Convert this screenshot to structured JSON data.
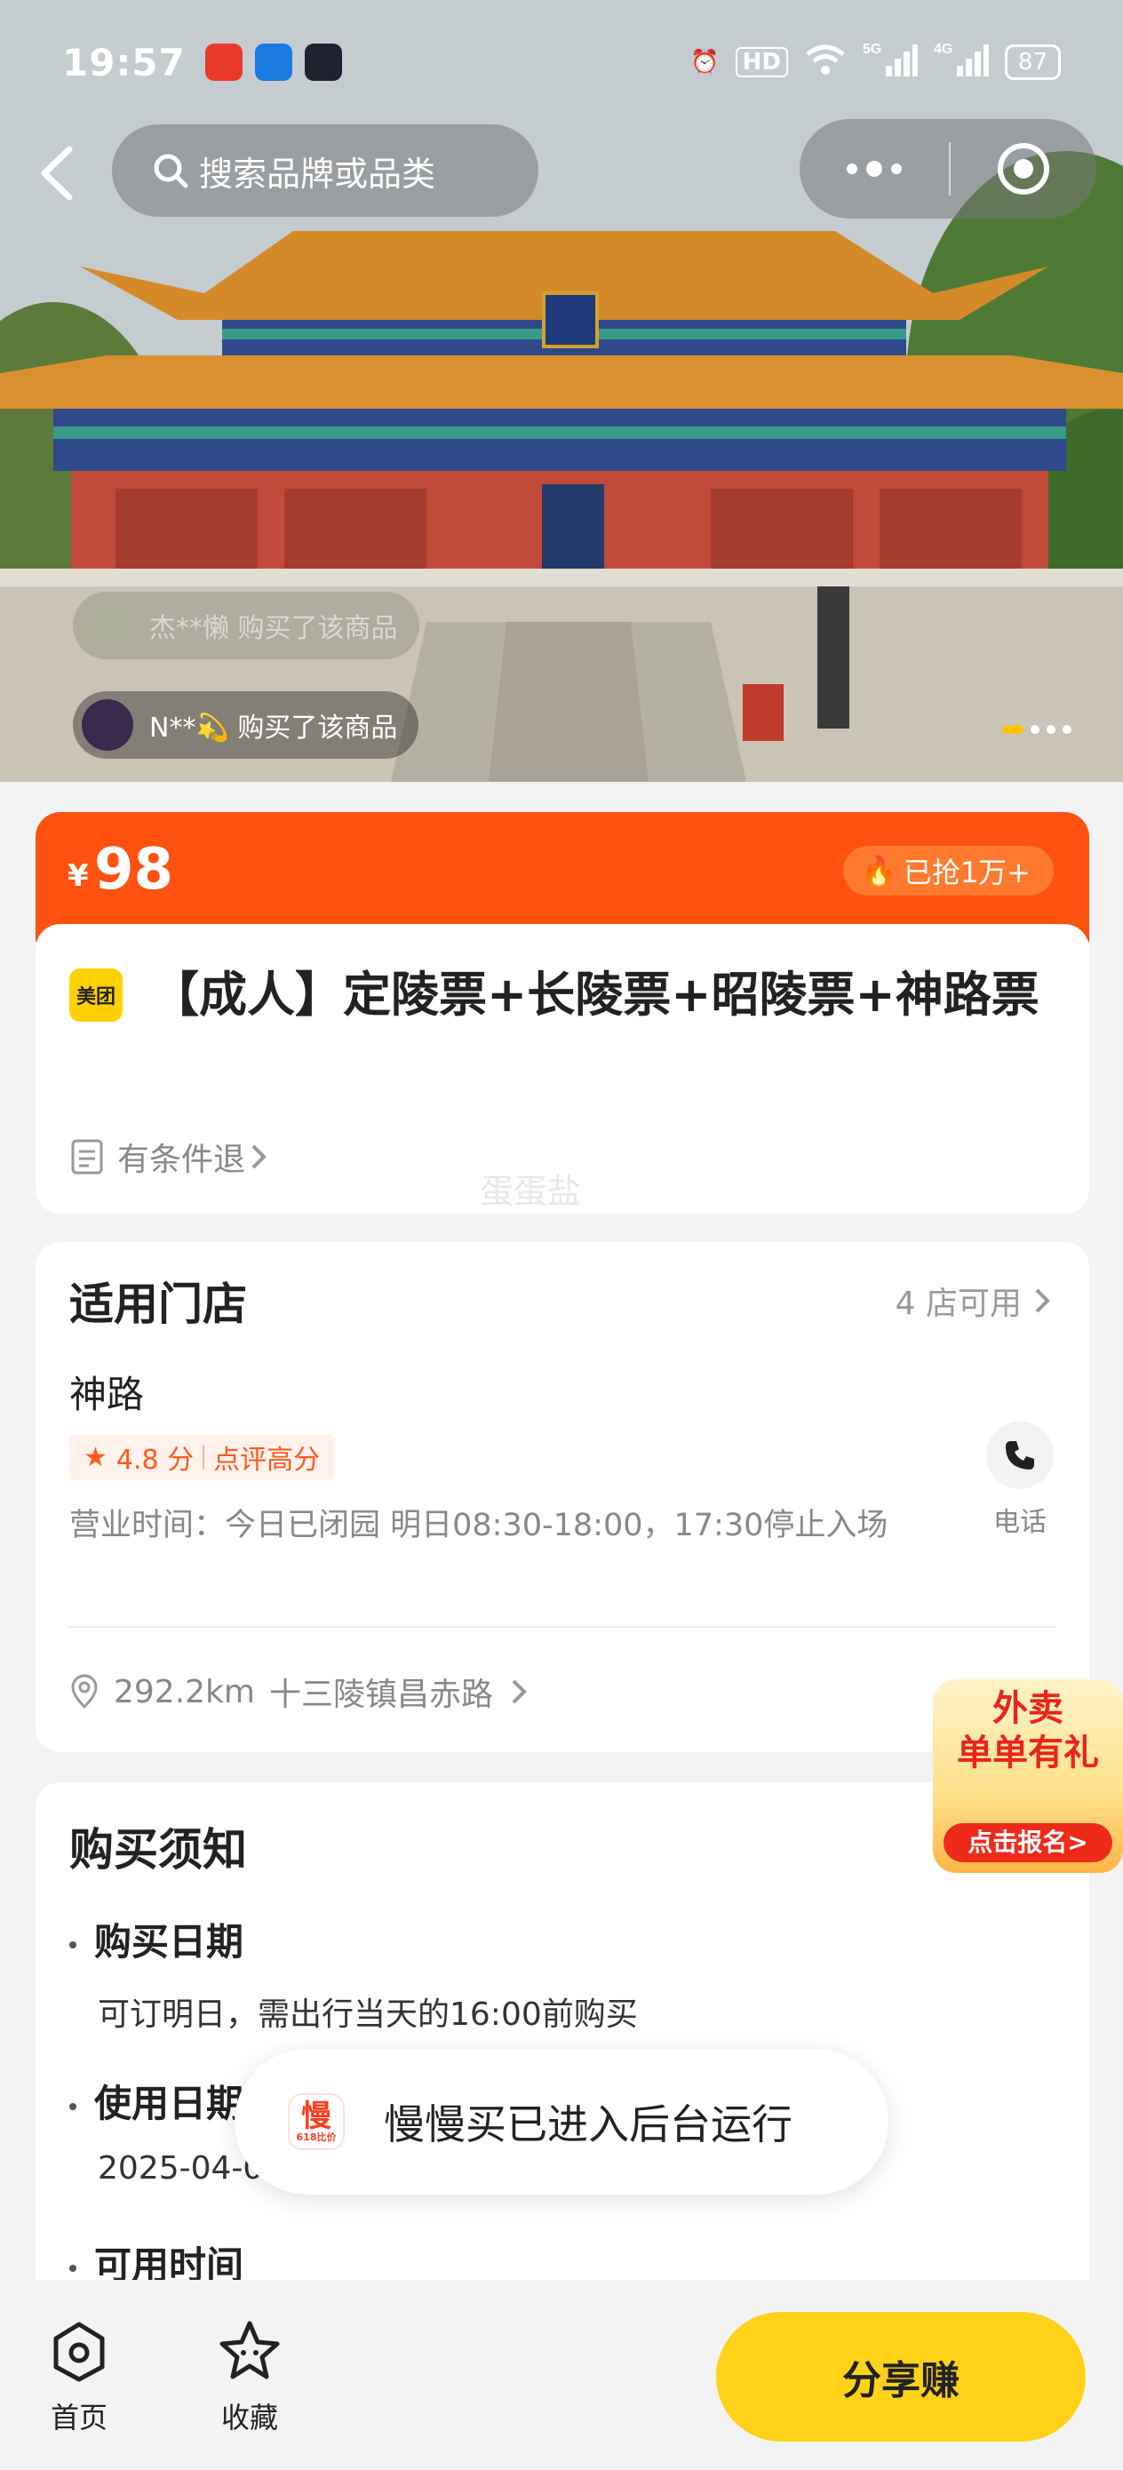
{
  "status_bar": {
    "time": "19:57",
    "battery": "87"
  },
  "header": {
    "search_placeholder": "搜索品牌或品类"
  },
  "hero": {
    "buyers": [
      "N**💫 购买了该商品",
      "杰**懒 购买了该商品"
    ],
    "slide_count": 4,
    "active_slide": 1
  },
  "price": {
    "symbol": "¥",
    "value": "98",
    "sold": "已抢1万+"
  },
  "product": {
    "brand_badge": "美团",
    "title": "【成人】定陵票+长陵票+昭陵票+神路票",
    "refund": "有条件退",
    "watermark": "蛋蛋盐"
  },
  "store": {
    "heading": "适用门店",
    "available": "4 店可用",
    "name": "神路",
    "rating": "4.8 分",
    "rating_tag": "点评高分",
    "hours": "营业时间：今日已闭园 明日08:30-18:00，17:30停止入场",
    "phone_label": "电话",
    "distance": "292.2km",
    "address": "十三陵镇昌赤路"
  },
  "notice": {
    "heading": "购买须知",
    "items": [
      {
        "label": "购买日期",
        "value": "可订明日，需出行当天的16:00前购买"
      },
      {
        "label": "使用日期",
        "value": "2025-04-0"
      },
      {
        "label": "可用时间",
        "value": ""
      }
    ]
  },
  "toast": {
    "logo_text": "慢",
    "logo_sub": "618比价",
    "message": "慢慢买已进入后台运行"
  },
  "promo": {
    "line1": "外卖",
    "line2": "单单有礼",
    "cta": "点击报名>"
  },
  "bottom_nav": {
    "home": "首页",
    "favorite": "收藏",
    "share": "分享赚"
  },
  "colors": {
    "accent_orange": "#ff5210",
    "share_yellow": "#ffd21a",
    "meituan_yellow": "#ffd100"
  }
}
